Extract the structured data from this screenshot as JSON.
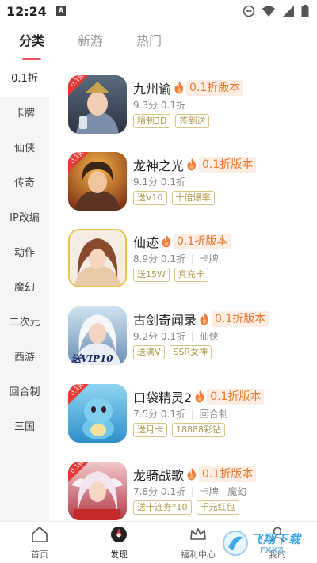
{
  "status_bar": {
    "time": "12:24",
    "notification_glyph": "A"
  },
  "top_tabs": [
    {
      "label": "分类",
      "active": true
    },
    {
      "label": "新游",
      "active": false
    },
    {
      "label": "热门",
      "active": false
    }
  ],
  "sidebar": {
    "items": [
      {
        "label": "0.1折",
        "active": true
      },
      {
        "label": "卡牌",
        "active": false
      },
      {
        "label": "仙侠",
        "active": false
      },
      {
        "label": "传奇",
        "active": false
      },
      {
        "label": "IP改编",
        "active": false
      },
      {
        "label": "动作",
        "active": false
      },
      {
        "label": "魔幻",
        "active": false
      },
      {
        "label": "二次元",
        "active": false
      },
      {
        "label": "西游",
        "active": false
      },
      {
        "label": "回合制",
        "active": false
      },
      {
        "label": "三国",
        "active": false
      }
    ]
  },
  "games": [
    {
      "name": "九州谕",
      "promo": "0.1折版本",
      "score": "9.3分",
      "discount": "0.1折",
      "genre": "",
      "tags": [
        "精制3D",
        "签到送"
      ],
      "icon": "game-icon-armored-warrior",
      "badge": "0.1折"
    },
    {
      "name": "龙神之光",
      "promo": "0.1折版本",
      "score": "9.1分",
      "discount": "0.1折",
      "genre": "",
      "tags": [
        "送V10",
        "十倍爆率"
      ],
      "icon": "game-icon-fire-warrior",
      "badge": "0.1折"
    },
    {
      "name": "仙迹",
      "promo": "0.1折版本",
      "score": "8.9分",
      "discount": "0.1折",
      "genre": "卡牌",
      "tags": [
        "送15W",
        "真充卡"
      ],
      "icon": "game-icon-fairy-lady",
      "badge": ""
    },
    {
      "name": "古剑奇闻录",
      "promo": "0.1折版本",
      "score": "9.2分",
      "discount": "0.1折",
      "genre": "仙侠",
      "tags": [
        "送满V",
        "SSR女神"
      ],
      "icon": "game-icon-white-haired-swordsman",
      "badge": "送VIP10"
    },
    {
      "name": "口袋精灵2",
      "promo": "0.1折版本",
      "score": "7.5分",
      "discount": "0.1折",
      "genre": "回合制",
      "tags": [
        "送月卡",
        "18888彩钻"
      ],
      "icon": "game-icon-blue-creature",
      "badge": "0.1折"
    },
    {
      "name": "龙骑战歌",
      "promo": "0.1折版本",
      "score": "7.8分",
      "discount": "0.1折",
      "genre": "卡牌 | 魔幻",
      "tags": [
        "送十连券*10",
        "千元红包"
      ],
      "icon": "game-icon-winged-heroine",
      "badge": "0.1折"
    }
  ],
  "bottom_nav": [
    {
      "label": "首页",
      "icon": "home-icon",
      "active": false
    },
    {
      "label": "发现",
      "icon": "discover-icon",
      "active": true
    },
    {
      "label": "福利中心",
      "icon": "crown-icon",
      "active": false
    },
    {
      "label": "我的",
      "icon": "profile-icon",
      "active": false
    }
  ],
  "watermark": {
    "text": "飞翔下载",
    "sub": "FXXZ"
  },
  "colors": {
    "accent": "#f0525a",
    "promo": "#e8762e",
    "tag": "#b59a4c"
  }
}
